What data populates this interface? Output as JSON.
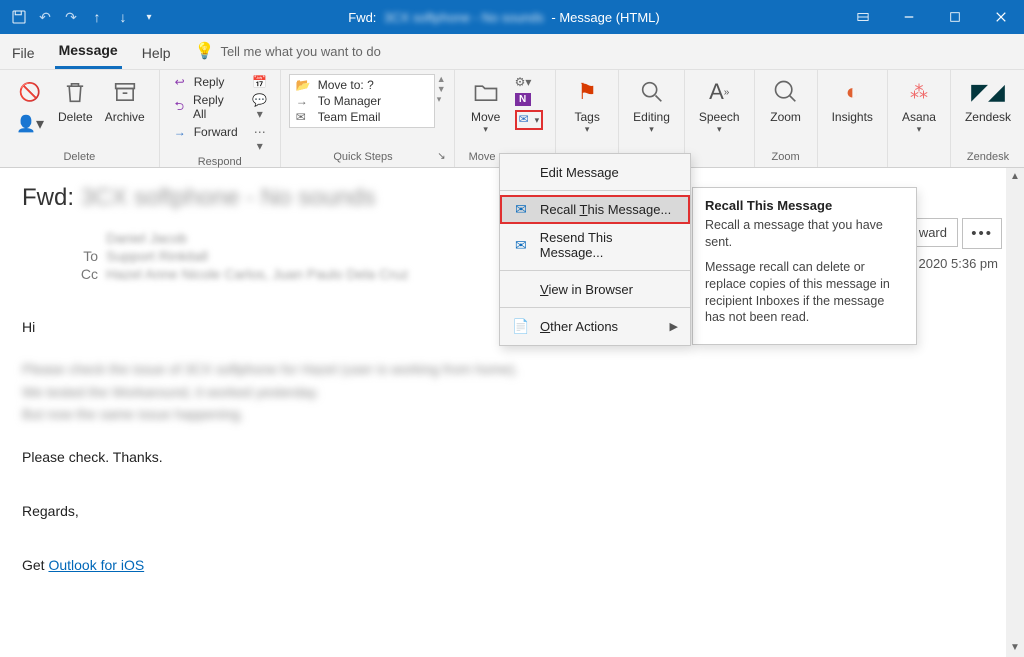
{
  "titlebar": {
    "prefix": "Fwd:",
    "hidden_subject": "3CX softphone - No sounds",
    "suffix": "- Message (HTML)"
  },
  "tabs": {
    "file": "File",
    "message": "Message",
    "help": "Help",
    "tell": "Tell me what you want to do"
  },
  "ribbon": {
    "delete_group": "Delete",
    "delete": "Delete",
    "archive": "Archive",
    "respond_group": "Respond",
    "reply": "Reply",
    "reply_all": "Reply All",
    "forward": "Forward",
    "quicksteps_group": "Quick Steps",
    "qs_moveto": "Move to: ?",
    "qs_tomgr": "To Manager",
    "qs_team": "Team Email",
    "move_group": "Move",
    "move": "Move",
    "tags": "Tags",
    "editing": "Editing",
    "speech": "Speech",
    "zoom_group": "Zoom",
    "zoom": "Zoom",
    "insights": "Insights",
    "asana": "Asana",
    "zendesk_group": "Zendesk",
    "zendesk": "Zendesk"
  },
  "menu": {
    "edit": "Edit Message",
    "recall_pre": "Recall ",
    "recall_accel": "T",
    "recall_post": "his Message...",
    "resend": "Resend This Message...",
    "view_pre": "",
    "view_accel": "V",
    "view_post": "iew in Browser",
    "other_pre": "",
    "other_accel": "O",
    "other_post": "ther Actions"
  },
  "tooltip": {
    "title": "Recall This Message",
    "line1": "Recall a message that you have sent.",
    "line2": "Message recall can delete or replace copies of this message in recipient Inboxes if the message has not been read."
  },
  "header": {
    "subject_prefix": "Fwd:",
    "subject_hidden": "3CX softphone - No sounds",
    "from_hidden": "Daniel Jacob",
    "to_label": "To",
    "to_hidden": "Support Rinkitall",
    "cc_label": "Cc",
    "cc_hidden": "Hazel Anne Nicole Carlos, Juan Paulo Dela Cruz",
    "timestamp": "2020 5:36 pm",
    "forward_btn": "ward",
    "more": "•••"
  },
  "body": {
    "hi": "Hi",
    "blur1": "Please check the issue of 3CX softphone for Hazel (user is working from home).",
    "blur2": "We tested the Workaround, it worked yesterday.",
    "blur3": "But now the same issue happening.",
    "check": "Please check. Thanks.",
    "regards": "Regards,",
    "get": "Get ",
    "link": "Outlook for iOS"
  }
}
